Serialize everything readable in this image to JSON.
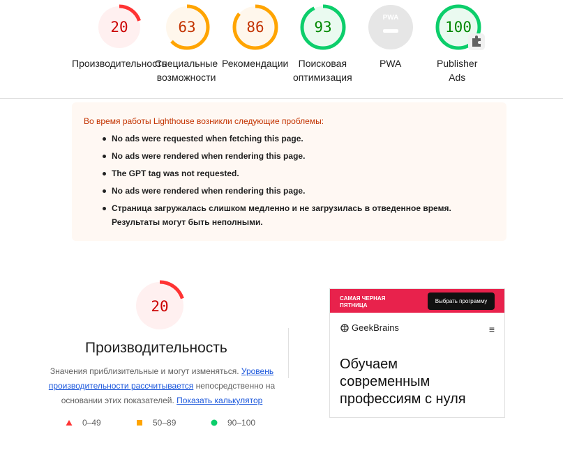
{
  "gauges": [
    {
      "score": "20",
      "label": "Производительность",
      "color": "#ff3333",
      "bg": "#fff0f0",
      "text": "#c00",
      "fraction": 0.2
    },
    {
      "score": "63",
      "label": "Специальные возможности",
      "label_line1": "Специальные",
      "label_line2": "возможности",
      "color": "#ffa400",
      "bg": "#fff7ec",
      "text": "#c33300",
      "fraction": 0.63
    },
    {
      "score": "86",
      "label": "Рекомендации",
      "color": "#ffa400",
      "bg": "#fff7ec",
      "text": "#c33300",
      "fraction": 0.86
    },
    {
      "score": "93",
      "label_line1": "Поисковая",
      "label_line2": "оптимизация",
      "color": "#0cce6b",
      "bg": "#eafaf0",
      "text": "#008800",
      "fraction": 0.93
    },
    {
      "score": "PWA",
      "label": "PWA",
      "color": "#bdbdbd",
      "bg": "#e8e8e8",
      "text": "#fff",
      "fraction": 0
    },
    {
      "score": "100",
      "label_line1": "Publisher",
      "label_line2": "Ads",
      "color": "#0cce6b",
      "bg": "#eafaf0",
      "text": "#008800",
      "fraction": 1.0
    }
  ],
  "warnings": {
    "title": "Во время работы Lighthouse возникли следующие проблемы:",
    "items": [
      "No ads were requested when fetching this page.",
      "No ads were rendered when rendering this page.",
      "The GPT tag was not requested.",
      "No ads were rendered when rendering this page.",
      "Страница загружалась слишком медленно и не загрузилась в отведенное время. Результаты могут быть неполными."
    ]
  },
  "performance": {
    "score": "20",
    "fraction": 0.2,
    "title": "Производительность",
    "desc_prefix": "Значения приблизительные и могут изменяться. ",
    "desc_link1": "Уровень производительности рассчитывается",
    "desc_middle": " непосредственно на основании этих показателей. ",
    "desc_link2": "Показать калькулятор"
  },
  "legend": [
    {
      "range": "0–49",
      "shape": "triangle",
      "color": "#ff3333"
    },
    {
      "range": "50–89",
      "shape": "square",
      "color": "#ffa400"
    },
    {
      "range": "90–100",
      "shape": "circle",
      "color": "#0cce6b"
    }
  ],
  "preview": {
    "promo_line1": "САМАЯ ЧЕРНАЯ",
    "promo_line2": "ПЯТНИЦА",
    "promo_button": "Выбрать программу",
    "logo_text": "GeekBrains",
    "headline_line1": "Обучаем",
    "headline_line2": "современным",
    "headline_line3": "профессиям с нуля"
  }
}
